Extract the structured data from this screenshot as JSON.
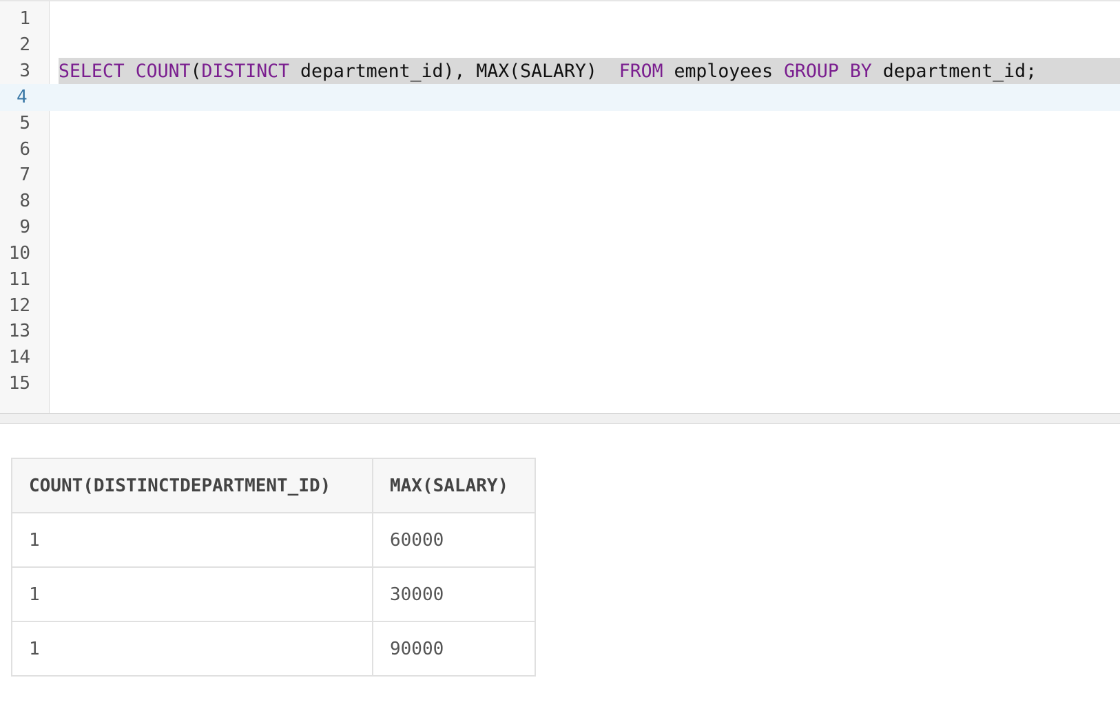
{
  "editor": {
    "line_numbers": [
      "1",
      "2",
      "3",
      "4",
      "5",
      "6",
      "7",
      "8",
      "9",
      "10",
      "11",
      "12",
      "13",
      "14",
      "15"
    ],
    "active_line": 4,
    "selected_line": 3,
    "code_line_3": {
      "t1": "SELECT",
      "t2": " ",
      "t3": "COUNT",
      "t4": "(",
      "t5": "DISTINCT",
      "t6": " department_id), MAX(SALARY)  ",
      "t7": "FROM",
      "t8": " employees ",
      "t9": "GROUP",
      "t10": " ",
      "t11": "BY",
      "t12": " department_id;"
    },
    "colors": {
      "keyword": "#7a1e8f",
      "selection": "#d9d9d9",
      "active_line": "#eef6fb"
    }
  },
  "results": {
    "columns": [
      "COUNT(DISTINCTDEPARTMENT_ID)",
      "MAX(SALARY)"
    ],
    "rows": [
      [
        "1",
        "60000"
      ],
      [
        "1",
        "30000"
      ],
      [
        "1",
        "90000"
      ]
    ]
  }
}
